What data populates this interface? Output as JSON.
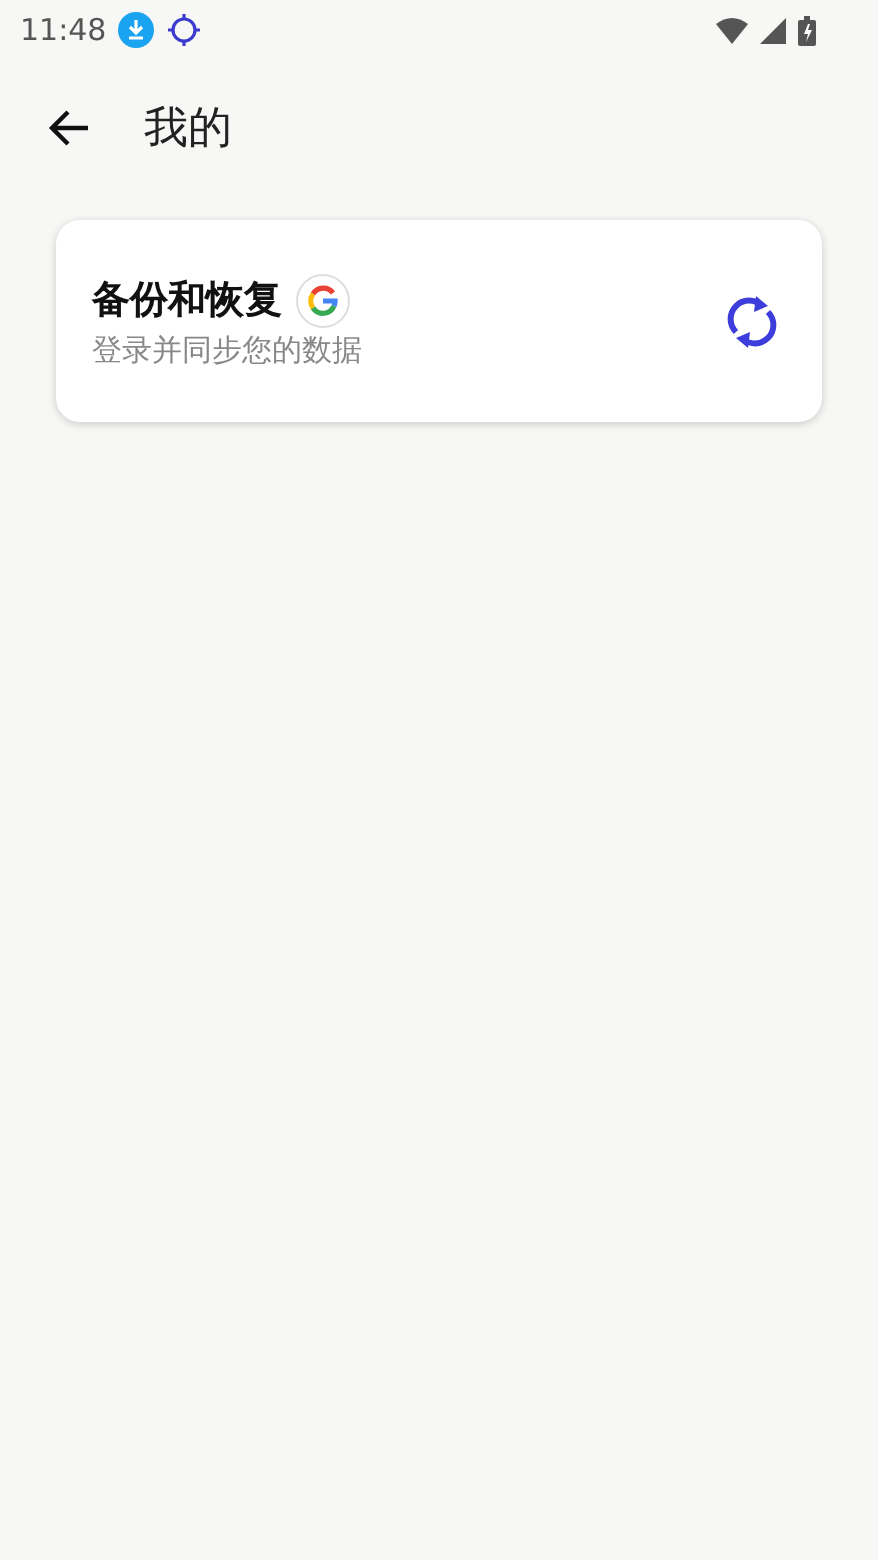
{
  "status_bar": {
    "time": "11:48"
  },
  "header": {
    "title": "我的"
  },
  "cards": [
    {
      "title": "备份和恢复",
      "subtitle": "登录并同步您的数据"
    }
  ]
}
